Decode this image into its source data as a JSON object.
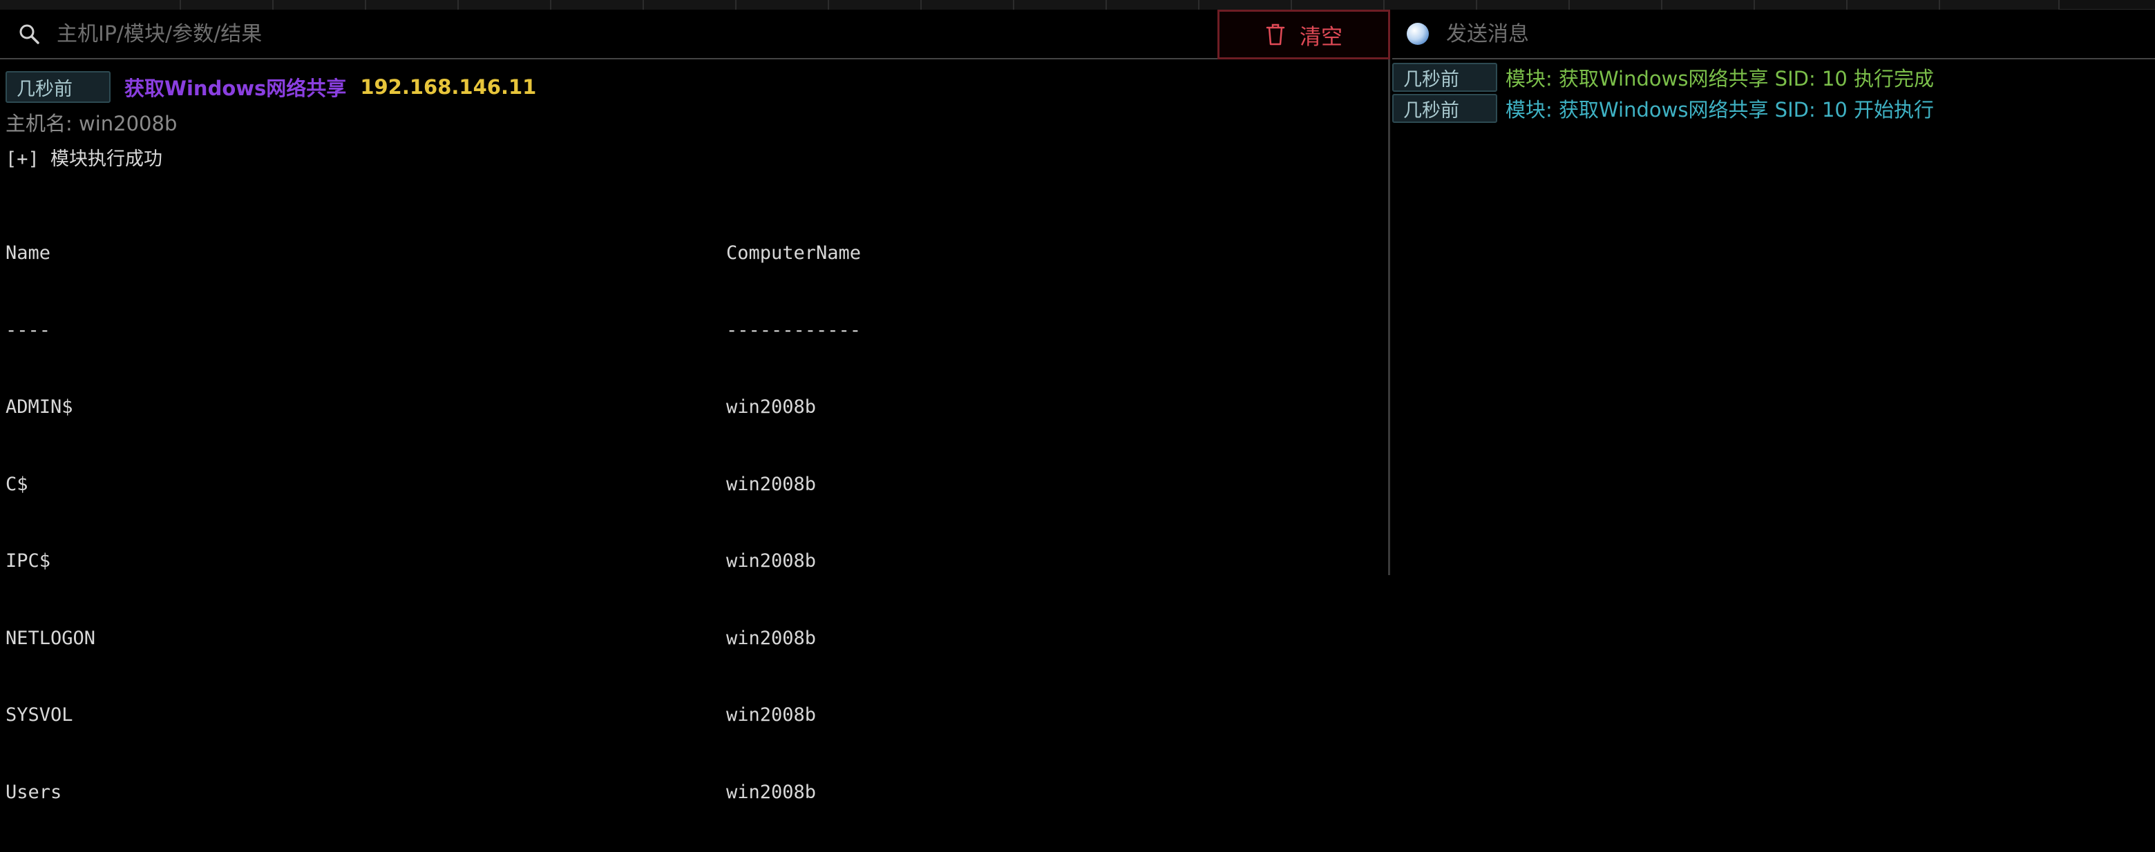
{
  "search": {
    "placeholder": "主机IP/模块/参数/结果",
    "icon": "search-icon"
  },
  "clear_button": {
    "label": "清空",
    "icon": "trash-icon",
    "color": "#e04a56"
  },
  "log_entry": {
    "time": "几秒前",
    "module": "获取Windows网络共享",
    "ip": "192.168.146.11",
    "hostname": "主机名: win2008b",
    "result": "[+] 模块执行成功",
    "table": {
      "headers": [
        "Name",
        "ComputerName"
      ],
      "separators": [
        "----",
        "------------"
      ],
      "rows": [
        [
          "ADMIN$",
          "win2008b"
        ],
        [
          "C$",
          "win2008b"
        ],
        [
          "IPC$",
          "win2008b"
        ],
        [
          "NETLOGON",
          "win2008b"
        ],
        [
          "SYSVOL",
          "win2008b"
        ],
        [
          "Users",
          "win2008b"
        ]
      ]
    },
    "colors": {
      "module": "#8a3fe0",
      "ip": "#e7c53b"
    }
  },
  "send": {
    "placeholder": "发送消息",
    "icon": "globe-icon"
  },
  "messages": [
    {
      "time": "几秒前",
      "text": "模块: 获取Windows网络共享 SID: 10 执行完成",
      "color": "#7bbf4a"
    },
    {
      "time": "几秒前",
      "text": "模块: 获取Windows网络共享 SID: 10 开始执行",
      "color": "#3fb2c4"
    }
  ]
}
